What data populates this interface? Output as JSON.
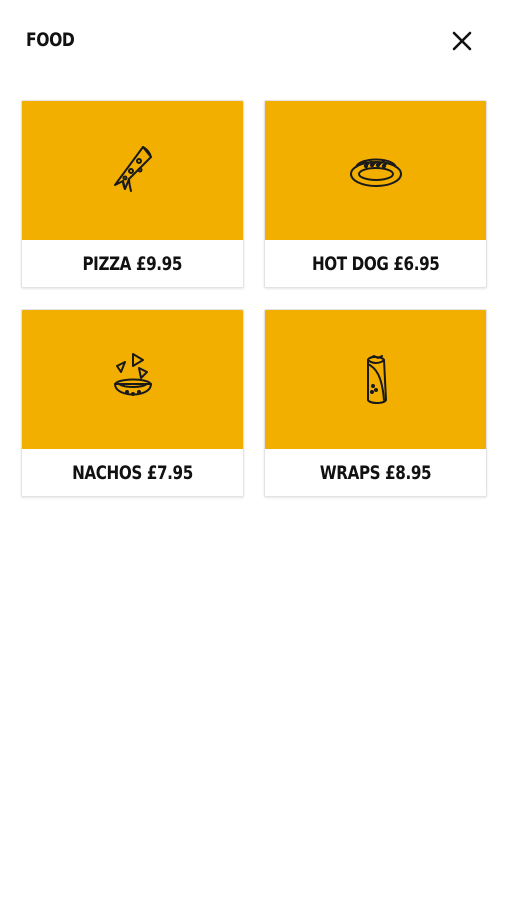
{
  "header": {
    "title": "FOOD",
    "close_icon": "close-icon"
  },
  "colors": {
    "accent": "#F2AF00",
    "text": "#111111",
    "background": "#FFFFFF"
  },
  "items": [
    {
      "label": "PIZZA £9.95",
      "icon": "pizza-slice-icon"
    },
    {
      "label": "HOT DOG £6.95",
      "icon": "hot-dog-icon"
    },
    {
      "label": "NACHOS £7.95",
      "icon": "nachos-icon"
    },
    {
      "label": "WRAPS £8.95",
      "icon": "wrap-icon"
    }
  ]
}
